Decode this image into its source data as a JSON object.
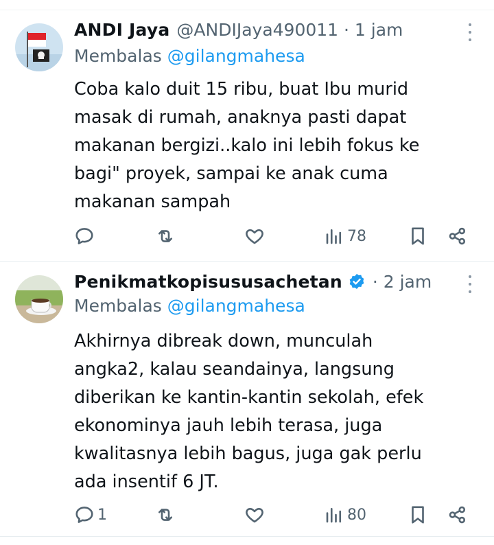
{
  "tweets": [
    {
      "name": "ANDI Jaya",
      "meta": "@ANDIJaya490011 · 1 jam",
      "replying_prefix": "Membalas",
      "replying_handle": "@gilangmahesa",
      "lines": [
        "Coba kalo duit 15 ribu, buat Ibu murid",
        "masak di rumah, anaknya pasti dapat",
        "makanan bergizi..kalo ini lebih fokus ke",
        "bagi\" proyek, sampai ke anak cuma",
        "makanan sampah"
      ],
      "reply_count": "",
      "retweet_count": "",
      "like_count": "",
      "views": "78",
      "verified": false
    },
    {
      "name": "Penikmatkopisususachetan",
      "meta": "· 2 jam",
      "replying_prefix": "Membalas",
      "replying_handle": "@gilangmahesa",
      "lines": [
        "Akhirnya dibreak down, munculah",
        "angka2, kalau seandainya, langsung",
        "diberikan ke kantin-kantin sekolah, efek",
        "ekonominya jauh lebih terasa, juga",
        "kwalitasnya lebih bagus, juga gak perlu",
        "ada insentif 6 JT."
      ],
      "reply_count": "1",
      "retweet_count": "",
      "like_count": "",
      "views": "80",
      "verified": true
    }
  ],
  "icons": {
    "reply": "reply-icon",
    "retweet": "retweet-icon",
    "like": "heart-icon",
    "views": "views-icon",
    "bookmark": "bookmark-icon",
    "share": "share-icon",
    "more": "more-icon",
    "verified": "verified-icon"
  },
  "colors": {
    "text": "#0f1419",
    "secondary": "#536471",
    "link": "#1d9bf0"
  }
}
